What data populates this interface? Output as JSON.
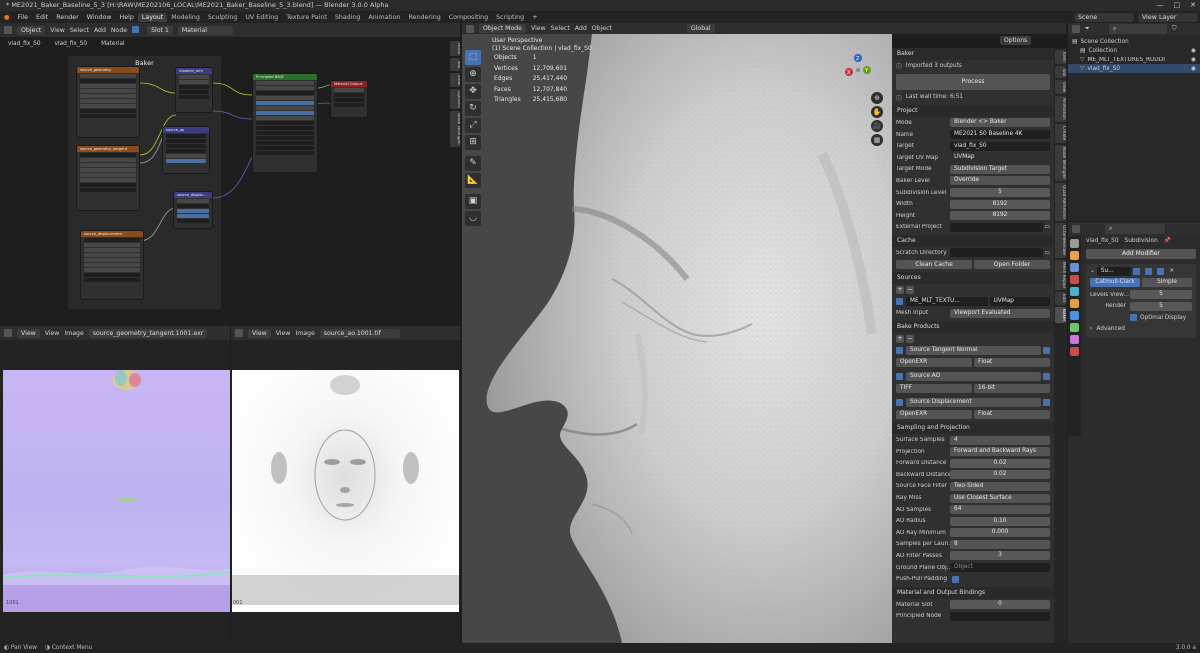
{
  "titlebar": {
    "title": "* ME2021_Baker_Baseline_5_3 [H:\\RAW\\ME202106_LOCAL\\ME2021_Baker_Baseline_5_3.blend] — Blender 3.0.0 Alpha",
    "min": "—",
    "max": "□",
    "close": "✕"
  },
  "menu": {
    "items": [
      "File",
      "Edit",
      "Render",
      "Window",
      "Help"
    ],
    "workspaces": [
      "Layout",
      "Modeling",
      "Sculpting",
      "UV Editing",
      "Texture Paint",
      "Shading",
      "Animation",
      "Rendering",
      "Compositing",
      "Scripting"
    ],
    "active_workspace": "Layout",
    "scene": "Scene",
    "view_layer": "View Layer"
  },
  "node_editor": {
    "header": {
      "object": "Object",
      "view": "View",
      "select": "Select",
      "add": "Add",
      "node": "Node",
      "slot": "Slot 1",
      "material": "Material"
    },
    "breadcrumb": {
      "obj": "vlad_fix_S0",
      "mesh": "vlad_fix_S0",
      "material": "Material"
    },
    "frame_label": "Baker",
    "side_tabs": [
      "Node",
      "Tool",
      "View",
      "Options",
      "Node Wrangler"
    ],
    "nodes": {
      "tex1": "source_geometry",
      "normal_map": "Vladimir_arm",
      "bsdf": "Principled BSDF",
      "material_output": "Material Output",
      "tex2": "source_geometry_tangent",
      "tex3": "source_displacement",
      "displacement": "source_displac...",
      "attr": "source_ao"
    }
  },
  "image_editor_left": {
    "view": "View",
    "view2": "View",
    "image": "Image",
    "filename": "source_geometry_tangent.1001.exr",
    "corner": "1001"
  },
  "image_editor_right": {
    "view": "View",
    "view2": "View",
    "image": "Image",
    "filename": "source_ao.1001.tif",
    "corner": "001"
  },
  "viewport": {
    "mode": "Object Mode",
    "view": "View",
    "select": "Select",
    "add": "Add",
    "object": "Object",
    "orientation": "Global",
    "options": "Options",
    "perspective": "User Perspective",
    "collection": "(1) Scene Collection | vlad_fix_S0",
    "stats": [
      {
        "label": "Objects",
        "value": "1"
      },
      {
        "label": "Vertices",
        "value": "12,709,601"
      },
      {
        "label": "Edges",
        "value": "25,417,440"
      },
      {
        "label": "Faces",
        "value": "12,707,840"
      },
      {
        "label": "Triangles",
        "value": "25,415,680"
      }
    ],
    "gizmo": {
      "z": "Z",
      "y": "Y",
      "x": "X"
    }
  },
  "baker": {
    "panel_title": "Baker",
    "status": "Imported 3 outputs",
    "process_label": "Process",
    "last_wall_time": "Last wall time: 6:51",
    "project_title": "Project",
    "project": [
      {
        "label": "Mode",
        "value": "Blender <> Baker"
      },
      {
        "label": "Name",
        "value": "ME2021 S0 Baseline 4K"
      },
      {
        "label": "Target",
        "value": "vlad_fix_S0"
      },
      {
        "label": "Target UV Map",
        "value": "UVMap"
      },
      {
        "label": "Target Mode",
        "value": "Subdivision Target"
      },
      {
        "label": "Baker Level",
        "value": "Override"
      },
      {
        "label": "Subdivision Level",
        "value": "5"
      },
      {
        "label": "Width",
        "value": "8192"
      },
      {
        "label": "Height",
        "value": "8192"
      },
      {
        "label": "External Project",
        "value": ""
      }
    ],
    "cache_title": "Cache",
    "scratch_label": "Scratch Directory",
    "clean_cache": "Clean Cache",
    "open_folder": "Open Folder",
    "sources_title": "Sources",
    "source_name": "ME_MLT_TEXTU...",
    "source_uv": "UVMap",
    "mesh_input_label": "Mesh Input",
    "mesh_input_value": "Viewport Evaluated",
    "bake_products_title": "Bake Products",
    "products": [
      {
        "name": "Source Tangent Normal",
        "format": "OpenEXR",
        "depth": "Float"
      },
      {
        "name": "Source AO",
        "format": "TIFF",
        "depth": "16-bit"
      },
      {
        "name": "Source Displacement",
        "format": "OpenEXR",
        "depth": "Float"
      }
    ],
    "sampling_title": "Sampling and Projection",
    "sampling": [
      {
        "label": "Surface Samples",
        "value": "4",
        "kind": "sel"
      },
      {
        "label": "Projection",
        "value": "Forward and Backward Rays",
        "kind": "sel"
      },
      {
        "label": "Forward Distance",
        "value": "0.02",
        "kind": "num"
      },
      {
        "label": "Backward Distance",
        "value": "0.02",
        "kind": "num"
      },
      {
        "label": "Source Face Filter",
        "value": "Two-Sided",
        "kind": "sel"
      },
      {
        "label": "Ray Miss",
        "value": "Use Closest Surface",
        "kind": "sel"
      },
      {
        "label": "AO Samples",
        "value": "64",
        "kind": "sel"
      },
      {
        "label": "AO Radius",
        "value": "0.10",
        "kind": "num"
      },
      {
        "label": "AO Ray Minimum",
        "value": "0.000",
        "kind": "num"
      },
      {
        "label": "Samples per Laun...",
        "value": "8",
        "kind": "sel"
      },
      {
        "label": "AO Filter Passes",
        "value": "3",
        "kind": "num"
      },
      {
        "label": "Ground Plane Obj...",
        "value": "Object",
        "kind": "dark"
      }
    ],
    "push_pull": "Push-Pull Padding",
    "bindings_title": "Material and Output Bindings",
    "material_slot_label": "Material Slot",
    "material_slot_value": "0",
    "principled_label": "Principled Node",
    "principled_value": ""
  },
  "npanel_tabs": [
    "Item",
    "Tool",
    "View",
    "Animation",
    "Create",
    "Node Wrangler",
    "Quad Remesher",
    "OctaneRender",
    "Mesh Repair",
    "Edit",
    "Baker"
  ],
  "outliner": {
    "search_placeholder": "",
    "items": [
      {
        "name": "Scene Collection",
        "indent": 0
      },
      {
        "name": "Collection",
        "indent": 1
      },
      {
        "name": "ME_MLT_TEXTURES_RUDDI",
        "indent": 1
      },
      {
        "name": "vlad_fix_S0",
        "indent": 1
      }
    ]
  },
  "properties": {
    "object": "vlad_fix_S0",
    "modifier_label": "Subdivision",
    "add_modifier": "Add Modifier",
    "mod_short": "Su...",
    "catmull": "Catmull-Clark",
    "simple": "Simple",
    "levels_viewport_label": "Levels View...",
    "levels_viewport": "5",
    "render_label": "Render",
    "render": "5",
    "optimal": "Optimal Display",
    "advanced": "Advanced",
    "tab_colors": [
      "#9a9a9a",
      "#e8a14a",
      "#6b8fd3",
      "#c64e4e",
      "#4bb3c9",
      "#e0a040",
      "#4f8fe8",
      "#6cc66c",
      "#c678dd",
      "#c64e4e"
    ]
  },
  "statusbar": {
    "pan": "Pan View",
    "context": "Context Menu",
    "version": "3.0.0 a"
  }
}
